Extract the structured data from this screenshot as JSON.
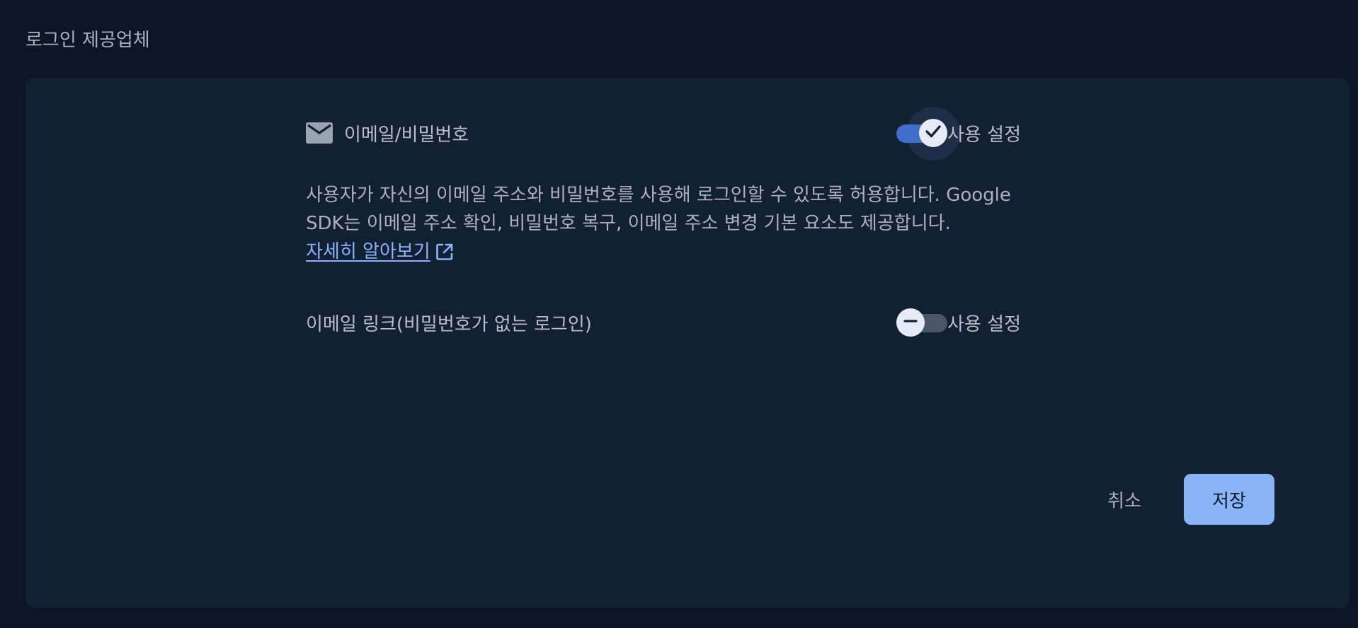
{
  "page": {
    "title": "로그인 제공업체"
  },
  "providers": {
    "email_password": {
      "label": "이메일/비밀번호",
      "toggle_state": "on",
      "toggle_label": "사용 설정",
      "description": "사용자가 자신의 이메일 주소와 비밀번호를 사용해 로그인할 수 있도록 허용합니다. Google SDK는 이메일 주소 확인, 비밀번호 복구, 이메일 주소 변경 기본 요소도 제공합니다.",
      "learn_more": "자세히 알아보기"
    },
    "email_link": {
      "label": "이메일 링크(비밀번호가 없는 로그인)",
      "toggle_state": "off",
      "toggle_label": "사용 설정"
    }
  },
  "actions": {
    "cancel": "취소",
    "save": "저장"
  },
  "colors": {
    "background": "#0b1524",
    "card": "#131f33",
    "accent": "#8ab4f8",
    "toggle_on_track": "#3f6fc9",
    "toggle_off_track": "#4a5566"
  },
  "icons": {
    "provider": "mail-icon",
    "learn_more": "open-in-new-icon",
    "toggle_on": "check-icon",
    "toggle_off": "minus-icon"
  }
}
